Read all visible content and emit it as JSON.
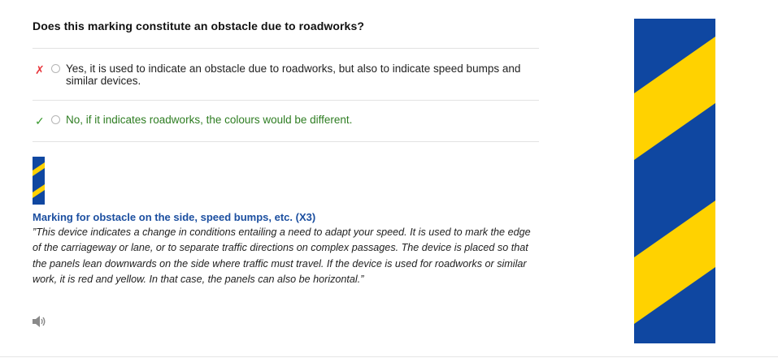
{
  "question": {
    "title": "Does this marking constitute an obstacle due to roadworks?"
  },
  "answers": [
    {
      "mark": "✗",
      "status": "wrong",
      "text": "Yes, it is used to indicate an obstacle due to roadworks, but also to indicate speed bumps and similar devices."
    },
    {
      "mark": "✓",
      "status": "correct",
      "text": "No, if it indicates roadworks, the colours would be different."
    }
  ],
  "explanation": {
    "title": "Marking for obstacle on the side, speed bumps, etc. (X3)",
    "text": "”This device indicates a change in conditions entailing a need to adapt your speed. It is used to mark the edge of the carriageway or lane, or to separate traffic directions on complex passages. The device is placed so that the panels lean downwards on the side where traffic must travel. If the device is used for roadworks or similar work, it is red and yellow. In that case, the panels can also be horizontal.”"
  },
  "audio": {
    "icon": "speaker-icon"
  },
  "sign": {
    "colors": {
      "blue": "#0f47a1",
      "yellow": "#ffd200"
    }
  },
  "colors": {
    "wrong_mark": "#e8373d",
    "correct_mark": "#3a9a2f",
    "correct_text": "#2e7d22",
    "explanation_title": "#1c4fa0"
  }
}
